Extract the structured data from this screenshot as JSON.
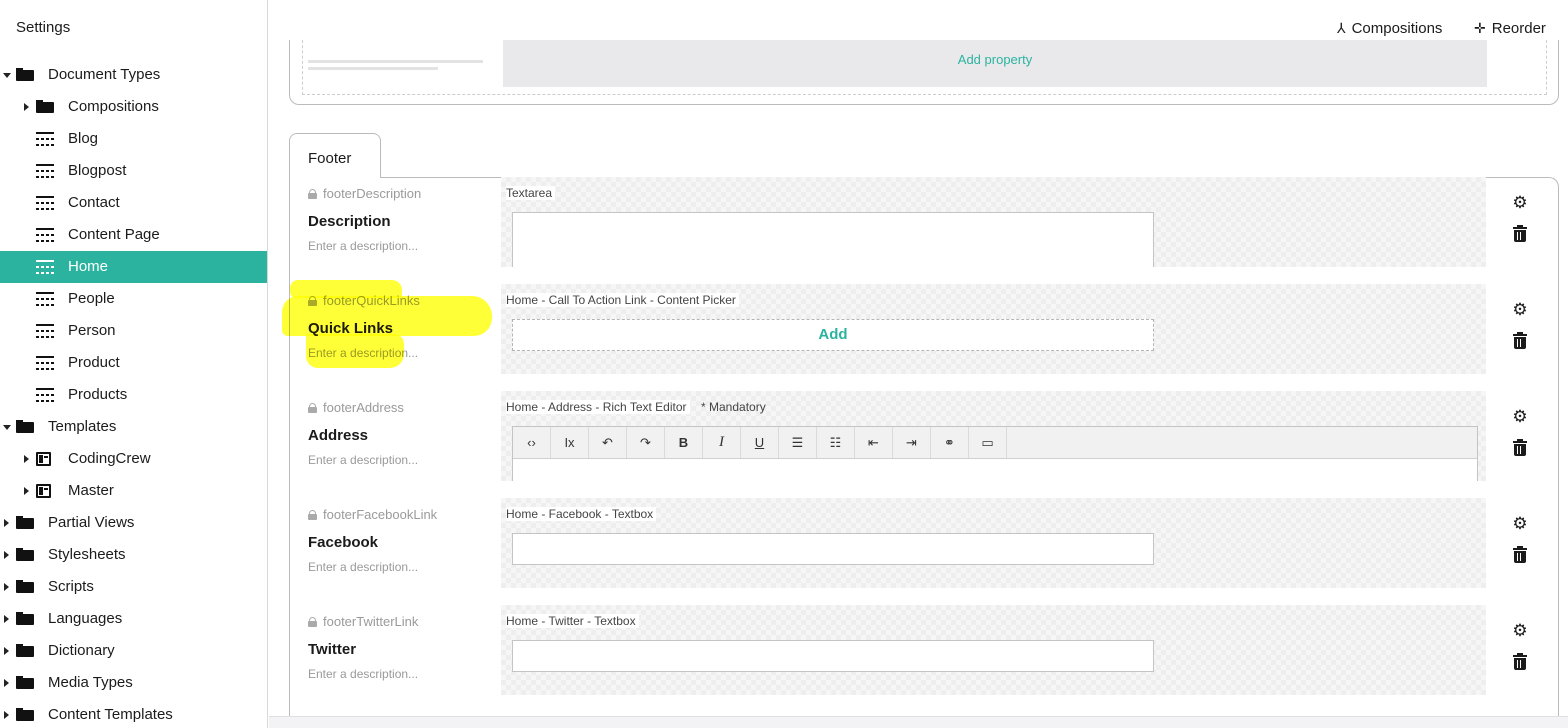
{
  "sidebar": {
    "title": "Settings",
    "items": [
      {
        "label": "Document Types",
        "icon": "folder-icon",
        "caret": "down"
      },
      {
        "label": "Compositions",
        "icon": "folder-icon",
        "caret": "right"
      },
      {
        "label": "Blog",
        "icon": "document-type-icon"
      },
      {
        "label": "Blogpost",
        "icon": "document-type-icon"
      },
      {
        "label": "Contact",
        "icon": "document-type-icon"
      },
      {
        "label": "Content Page",
        "icon": "document-type-icon"
      },
      {
        "label": "Home",
        "icon": "document-type-icon",
        "active": true
      },
      {
        "label": "People",
        "icon": "document-type-icon"
      },
      {
        "label": "Person",
        "icon": "document-type-icon"
      },
      {
        "label": "Product",
        "icon": "document-type-icon"
      },
      {
        "label": "Products",
        "icon": "document-type-icon"
      },
      {
        "label": "Templates",
        "icon": "folder-icon",
        "caret": "down"
      },
      {
        "label": "CodingCrew",
        "icon": "template-icon",
        "caret": "right"
      },
      {
        "label": "Master",
        "icon": "template-icon",
        "caret": "right"
      },
      {
        "label": "Partial Views",
        "icon": "folder-icon",
        "caret": "right"
      },
      {
        "label": "Stylesheets",
        "icon": "folder-icon",
        "caret": "right"
      },
      {
        "label": "Scripts",
        "icon": "folder-icon",
        "caret": "right"
      },
      {
        "label": "Languages",
        "icon": "folder-icon",
        "caret": "right"
      },
      {
        "label": "Dictionary",
        "icon": "folder-icon",
        "caret": "right"
      },
      {
        "label": "Media Types",
        "icon": "folder-icon",
        "caret": "right"
      },
      {
        "label": "Content Templates",
        "icon": "folder-icon",
        "caret": "right"
      }
    ]
  },
  "toolbar": {
    "compositions_label": "Compositions",
    "reorder_label": "Reorder"
  },
  "previous_group": {
    "add_property_label": "Add property"
  },
  "group": {
    "tab_label": "Footer",
    "properties": [
      {
        "alias": "footerDescription",
        "label": "Description",
        "description_placeholder": "Enter a description...",
        "editor": "Textarea",
        "mandatory": "",
        "kind": "textarea"
      },
      {
        "alias": "footerQuickLinks",
        "label": "Quick Links",
        "description_placeholder": "Enter a description...",
        "editor": "Home - Call To Action Link - Content Picker",
        "mandatory": "",
        "kind": "picker",
        "add_label": "Add"
      },
      {
        "alias": "footerAddress",
        "label": "Address",
        "description_placeholder": "Enter a description...",
        "editor": "Home - Address - Rich Text Editor",
        "mandatory": "* Mandatory",
        "kind": "rte"
      },
      {
        "alias": "footerFacebookLink",
        "label": "Facebook",
        "description_placeholder": "Enter a description...",
        "editor": "Home - Facebook - Textbox",
        "mandatory": "",
        "kind": "textbox"
      },
      {
        "alias": "footerTwitterLink",
        "label": "Twitter",
        "description_placeholder": "Enter a description...",
        "editor": "Home - Twitter - Textbox",
        "mandatory": "",
        "kind": "textbox"
      }
    ]
  },
  "rte_toolbar": [
    "code-icon",
    "clear-format-icon",
    "undo-icon",
    "redo-icon",
    "bold-icon",
    "italic-icon",
    "underline-icon",
    "bullet-list-icon",
    "numbered-list-icon",
    "outdent-icon",
    "indent-icon",
    "link-icon",
    "embed-icon"
  ],
  "rte_glyphs": [
    "‹›",
    "Ix",
    "↶",
    "↷",
    "B",
    "I",
    "U",
    "☰",
    "☷",
    "⇤",
    "⇥",
    "⚭",
    "▭"
  ],
  "colors": {
    "accent": "#2bb3a0",
    "highlight": "#ffff00"
  }
}
